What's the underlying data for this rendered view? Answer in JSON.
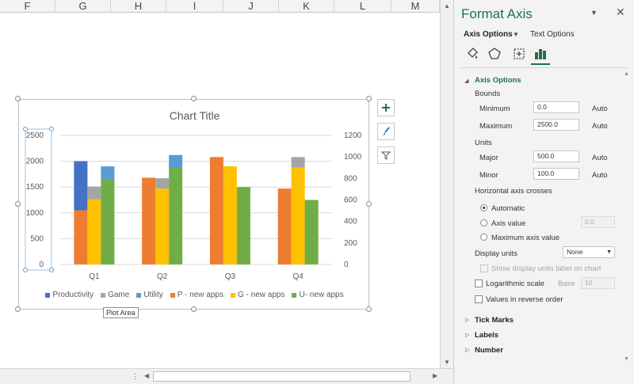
{
  "sheet": {
    "columns": [
      "F",
      "G",
      "H",
      "I",
      "J",
      "K",
      "L",
      "M"
    ]
  },
  "chart": {
    "title": "Chart Title",
    "tooltip": "Plot Area",
    "add_element_icon": "plus-icon",
    "style_icon": "brush-icon",
    "filter_icon": "funnel-icon"
  },
  "chart_data": {
    "type": "bar",
    "categories": [
      "Q1",
      "Q2",
      "Q3",
      "Q4"
    ],
    "y_left": {
      "ticks": [
        0,
        500,
        1000,
        1500,
        2000,
        2500
      ],
      "ylim": [
        0,
        2500
      ]
    },
    "y_right": {
      "ticks": [
        0,
        200,
        400,
        600,
        800,
        1000,
        1200
      ],
      "ylim": [
        0,
        1200
      ]
    },
    "grid": true,
    "legend_position": "bottom",
    "stacked_series": [
      {
        "name": "Productivity",
        "color": "#4472C4",
        "values": [
          950,
          0,
          0,
          0
        ]
      },
      {
        "name": "Game",
        "color": "#A5A5A5",
        "values": [
          250,
          200,
          0,
          200
        ]
      },
      {
        "name": "Utility",
        "color": "#5B9BD5",
        "values": [
          250,
          250,
          0,
          0
        ]
      }
    ],
    "base_series": [
      {
        "name": "P - new apps",
        "color": "#ED7D31",
        "values": [
          1050,
          1680,
          2080,
          1470
        ]
      },
      {
        "name": "G - new apps",
        "color": "#FFC000",
        "values": [
          1260,
          1470,
          1900,
          1880
        ]
      },
      {
        "name": "U- new apps",
        "color": "#70AD47",
        "values": [
          1650,
          1870,
          1500,
          1250
        ]
      }
    ],
    "legend_order": [
      "Productivity",
      "Game",
      "Utility",
      "P - new apps",
      "G - new apps",
      "U- new apps"
    ]
  },
  "pane": {
    "title": "Format Axis",
    "menu_icon": "chevron-down-icon",
    "close_icon": "close-icon",
    "tab_axis_options": "Axis Options",
    "tab_text_options": "Text Options",
    "icons": [
      "fill-line-icon",
      "effects-pentagon-icon",
      "size-properties-icon",
      "axis-options-bar-icon"
    ],
    "section_axis_options": "Axis Options",
    "bounds_label": "Bounds",
    "minimum_label": "Minimum",
    "minimum_value": "0.0",
    "minimum_mode": "Auto",
    "maximum_label": "Maximum",
    "maximum_value": "2500.0",
    "maximum_mode": "Auto",
    "units_label": "Units",
    "major_label": "Major",
    "major_value": "500.0",
    "major_mode": "Auto",
    "minor_label": "Minor",
    "minor_value": "100.0",
    "minor_mode": "Auto",
    "crosses_label": "Horizontal axis crosses",
    "radio_automatic": "Automatic",
    "radio_axis_value": "Axis value",
    "axis_value_input": "0.0",
    "radio_max_axis_value": "Maximum axis value",
    "display_units_label": "Display units",
    "display_units_value": "None",
    "show_units_label": "Show display units label on chart",
    "log_scale_label": "Logarithmic scale",
    "base_label": "Base",
    "base_value": "10",
    "reverse_label": "Values in reverse order",
    "section_tick_marks": "Tick Marks",
    "section_labels": "Labels",
    "section_number": "Number"
  }
}
